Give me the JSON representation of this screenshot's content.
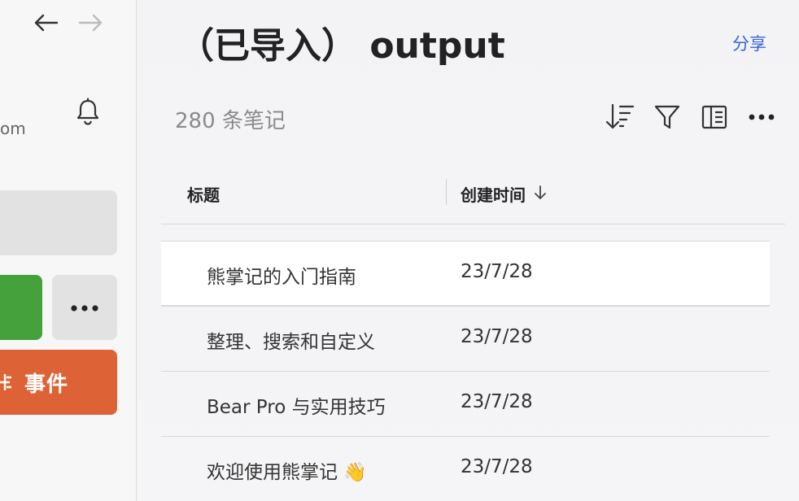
{
  "sidebar": {
    "email_fragment": "om",
    "events_label": "事件",
    "colors": {
      "green": "#45a13c",
      "orange": "#dd6336"
    }
  },
  "header": {
    "title": "（已导入） output",
    "share_label": "分享",
    "note_count": "280 条笔记"
  },
  "columns": {
    "title_label": "标题",
    "date_label": "创建时间",
    "sort_direction": "descending"
  },
  "notes": [
    {
      "title": "熊掌记的入门指南",
      "created": "23/7/28"
    },
    {
      "title": "整理、搜索和自定义",
      "created": "23/7/28"
    },
    {
      "title": "Bear Pro 与实用技巧",
      "created": "23/7/28"
    },
    {
      "title": "欢迎使用熊掌记 👋",
      "created": "23/7/28"
    }
  ],
  "icons": [
    "back-arrow-icon",
    "forward-arrow-icon",
    "bell-icon",
    "more-icon",
    "sort-icon",
    "filter-icon",
    "layout-icon",
    "more-options-icon",
    "sort-down-icon"
  ]
}
